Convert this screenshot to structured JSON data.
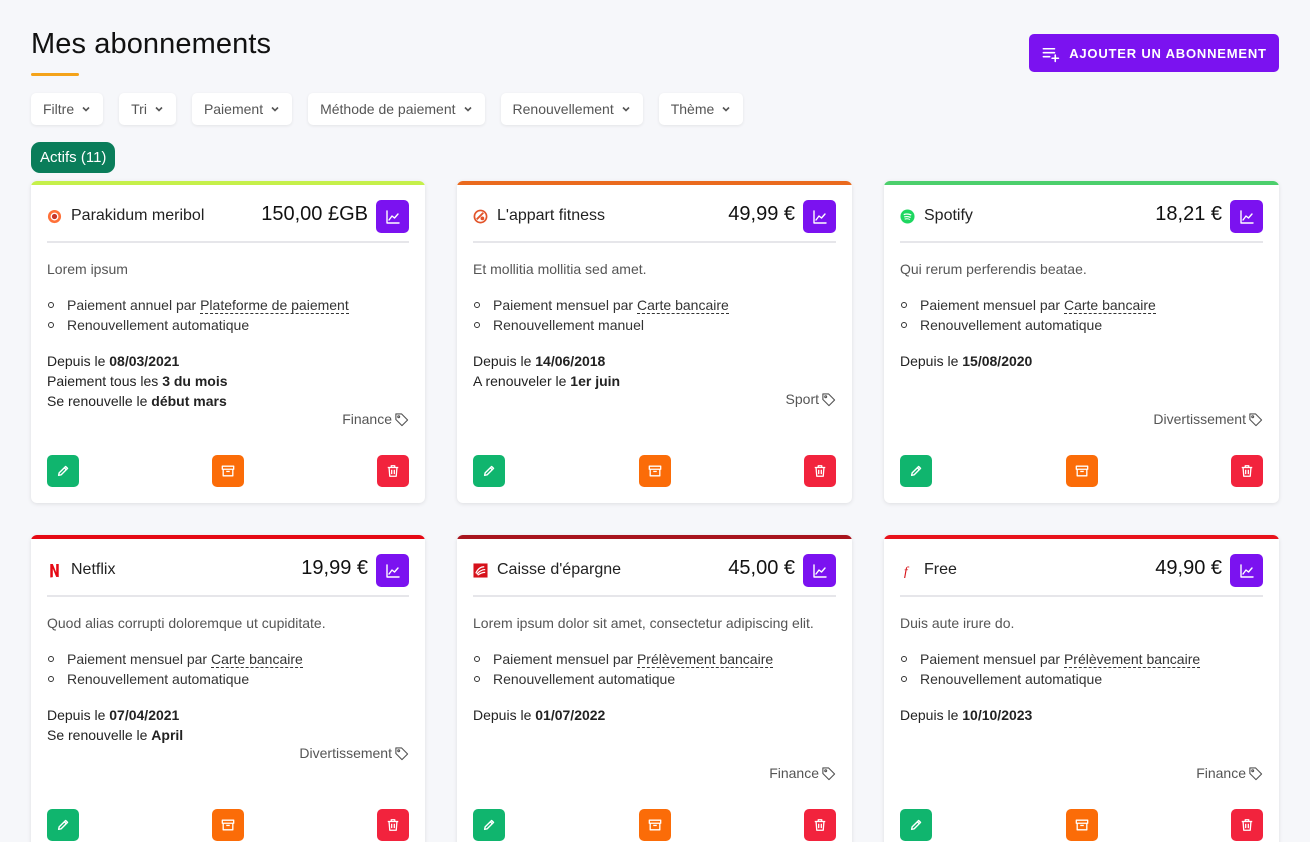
{
  "header": {
    "title": "Mes abonnements",
    "add_label": "AJOUTER UN ABONNEMENT"
  },
  "filters": [
    "Filtre",
    "Tri",
    "Paiement",
    "Méthode de paiement",
    "Renouvellement",
    "Thème"
  ],
  "status_badge": "Actifs (11)",
  "colors": {
    "primary": "#7b12f0",
    "accent_underline": "#f4a31a",
    "badge": "#0a7d5a",
    "edit": "#10b56e",
    "archive": "#fb6c08",
    "delete": "#f2233d"
  },
  "cards": [
    {
      "name": "Parakidum meribol",
      "price": "150,00 £GB",
      "bar_color": "#c5f04a",
      "logo_icon": "firefox-logo-icon",
      "description": "Lorem ipsum",
      "payment_prefix": "Paiement annuel par",
      "payment_method": "Plateforme de paiement",
      "renewal": "Renouvellement automatique",
      "info": [
        {
          "label": "Depuis le",
          "value": "08/03/2021"
        },
        {
          "label": "Paiement tous les",
          "value": "3 du mois"
        },
        {
          "label": "Se renouvelle le",
          "value": "début mars"
        }
      ],
      "tag": "Finance"
    },
    {
      "name": "L'appart fitness",
      "price": "49,99 €",
      "bar_color": "#ea6a1e",
      "logo_icon": "fitness-logo-icon",
      "description": "Et mollitia mollitia sed amet.",
      "payment_prefix": "Paiement mensuel par",
      "payment_method": "Carte bancaire",
      "renewal": "Renouvellement manuel",
      "info": [
        {
          "label": "Depuis le",
          "value": "14/06/2018"
        },
        {
          "label": "A renouveler le",
          "value": "1er juin"
        }
      ],
      "tag": "Sport"
    },
    {
      "name": "Spotify",
      "price": "18,21 €",
      "bar_color": "#4ccf6c",
      "logo_icon": "spotify-logo-icon",
      "description": "Qui rerum perferendis beatae.",
      "payment_prefix": "Paiement mensuel par",
      "payment_method": "Carte bancaire",
      "renewal": "Renouvellement automatique",
      "info": [
        {
          "label": "Depuis le",
          "value": "15/08/2020"
        }
      ],
      "tag": "Divertissement"
    },
    {
      "name": "Netflix",
      "price": "19,99 €",
      "bar_color": "#e50914",
      "logo_icon": "netflix-logo-icon",
      "description": "Quod alias corrupti doloremque ut cupiditate.",
      "payment_prefix": "Paiement mensuel par",
      "payment_method": "Carte bancaire",
      "renewal": "Renouvellement automatique",
      "info": [
        {
          "label": "Depuis le",
          "value": "07/04/2021"
        },
        {
          "label": "Se renouvelle le",
          "value": "April"
        }
      ],
      "tag": "Divertissement"
    },
    {
      "name": "Caisse d'épargne",
      "price": "45,00 €",
      "bar_color": "#a8141d",
      "logo_icon": "caisse-epargne-logo-icon",
      "description": "Lorem ipsum dolor sit amet, consectetur adipiscing elit.",
      "payment_prefix": "Paiement mensuel par",
      "payment_method": "Prélèvement bancaire",
      "renewal": "Renouvellement automatique",
      "info": [
        {
          "label": "Depuis le",
          "value": "01/07/2022"
        }
      ],
      "tag": "Finance"
    },
    {
      "name": "Free",
      "price": "49,90 €",
      "bar_color": "#e8121b",
      "logo_icon": "free-logo-icon",
      "description": "Duis aute irure do.",
      "payment_prefix": "Paiement mensuel par",
      "payment_method": "Prélèvement bancaire",
      "renewal": "Renouvellement automatique",
      "info": [
        {
          "label": "Depuis le",
          "value": "10/10/2023"
        }
      ],
      "tag": "Finance"
    }
  ]
}
